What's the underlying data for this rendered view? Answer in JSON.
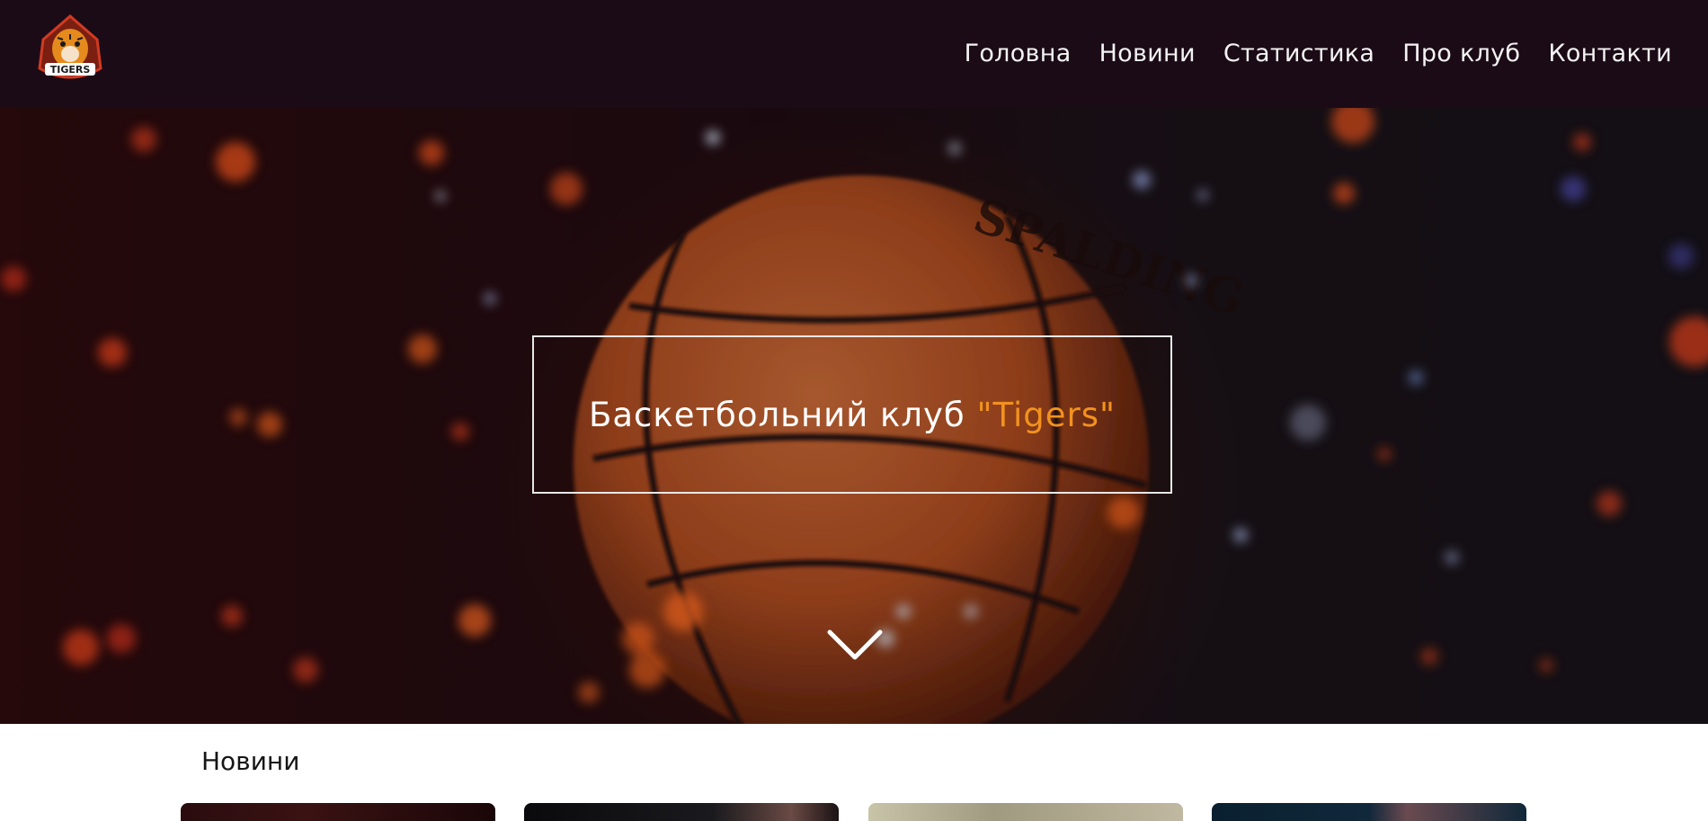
{
  "header": {
    "logo_text": "TIGERS",
    "nav": [
      {
        "label": "Головна"
      },
      {
        "label": "Новини"
      },
      {
        "label": "Статистика"
      },
      {
        "label": "Про клуб"
      },
      {
        "label": "Контакти"
      }
    ]
  },
  "hero": {
    "title_main": "Баскетбольний клуб ",
    "title_accent": "\"Tigers\"",
    "scroll_icon": "chevron-down-icon",
    "ball_text": "SPALDING"
  },
  "news": {
    "heading": "Новини",
    "cards": [
      {
        "name": "news-card-1"
      },
      {
        "name": "news-card-2"
      },
      {
        "name": "news-card-3"
      },
      {
        "name": "news-card-4"
      }
    ]
  },
  "colors": {
    "header_bg": "#1b0b16",
    "accent": "#f2921e",
    "text_light": "#ffffff"
  }
}
